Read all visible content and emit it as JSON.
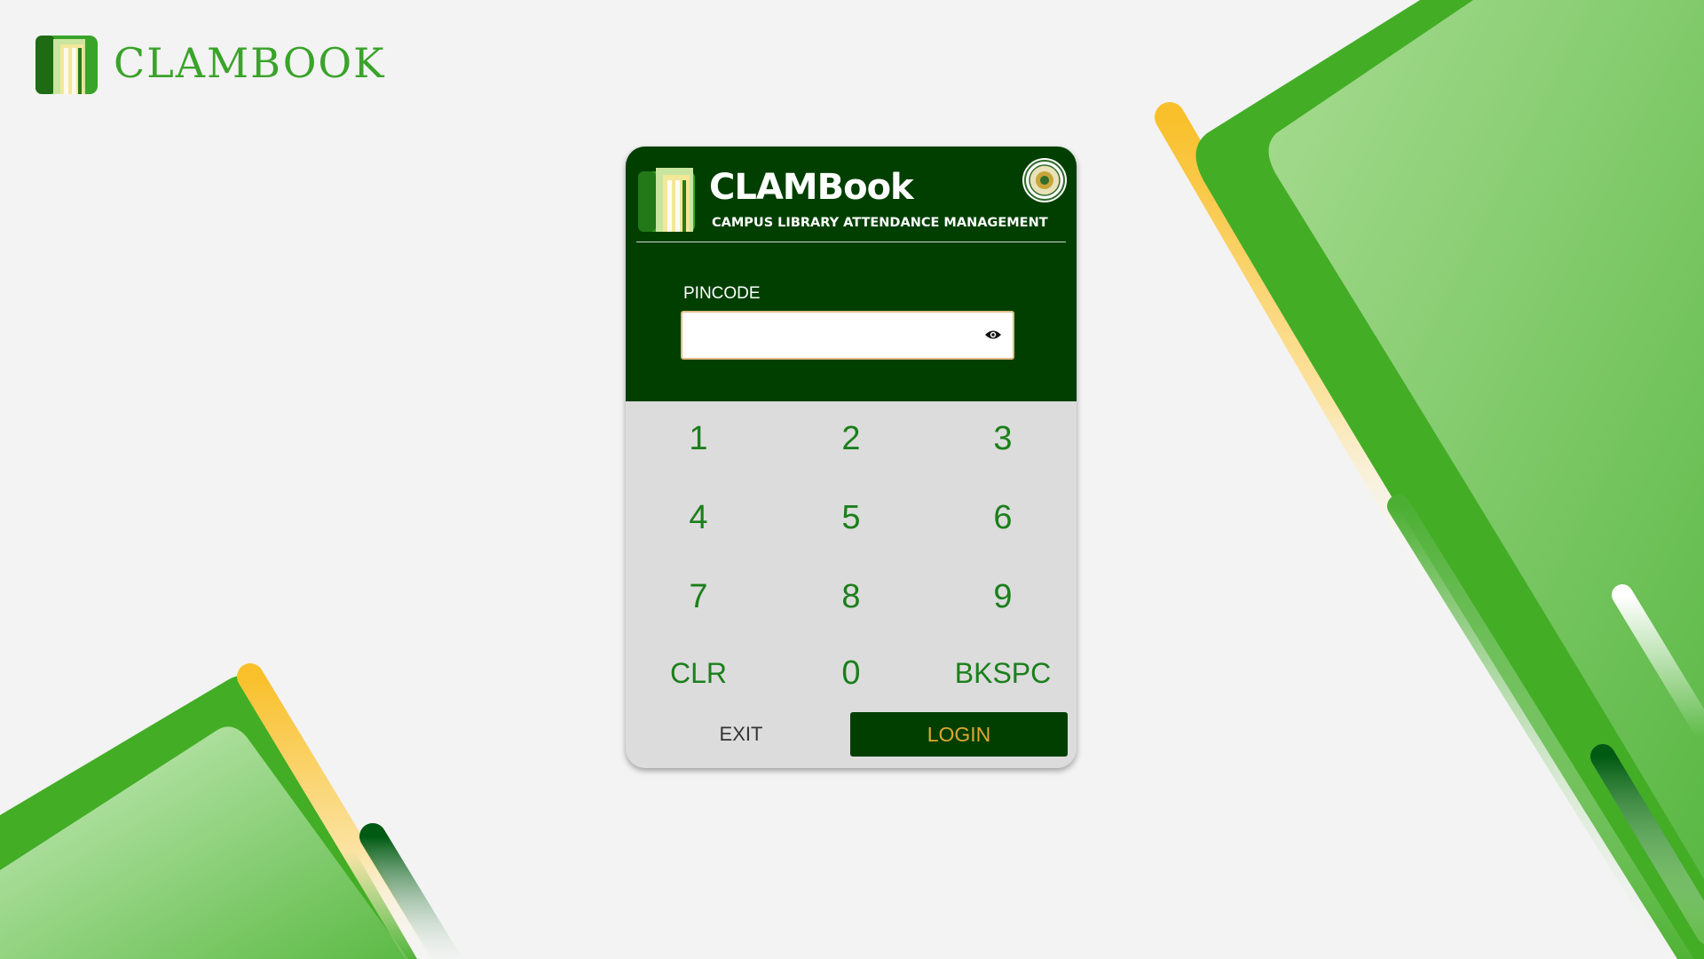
{
  "brand": {
    "name": "CLAMBOOK"
  },
  "card": {
    "title": "CLAMBook",
    "subtitle": "CAMPUS LIBRARY ATTENDANCE MANAGEMENT",
    "seal_icon": "school-seal-icon"
  },
  "pin": {
    "label": "PINCODE",
    "value": "",
    "placeholder": "",
    "visibility_icon": "eye-icon"
  },
  "keypad": {
    "keys": [
      "1",
      "2",
      "3",
      "4",
      "5",
      "6",
      "7",
      "8",
      "9",
      "CLR",
      "0",
      "BKSPC"
    ]
  },
  "actions": {
    "exit_label": "EXIT",
    "login_label": "LOGIN"
  },
  "colors": {
    "background": "#f3f3f3",
    "header_green": "#003f00",
    "accent_green": "#3aa32a",
    "keypad_bg": "#dcdcdc",
    "key_text": "#1b7f1b",
    "login_text": "#e0a82e",
    "stripe_yellow": "#f9c02b"
  }
}
